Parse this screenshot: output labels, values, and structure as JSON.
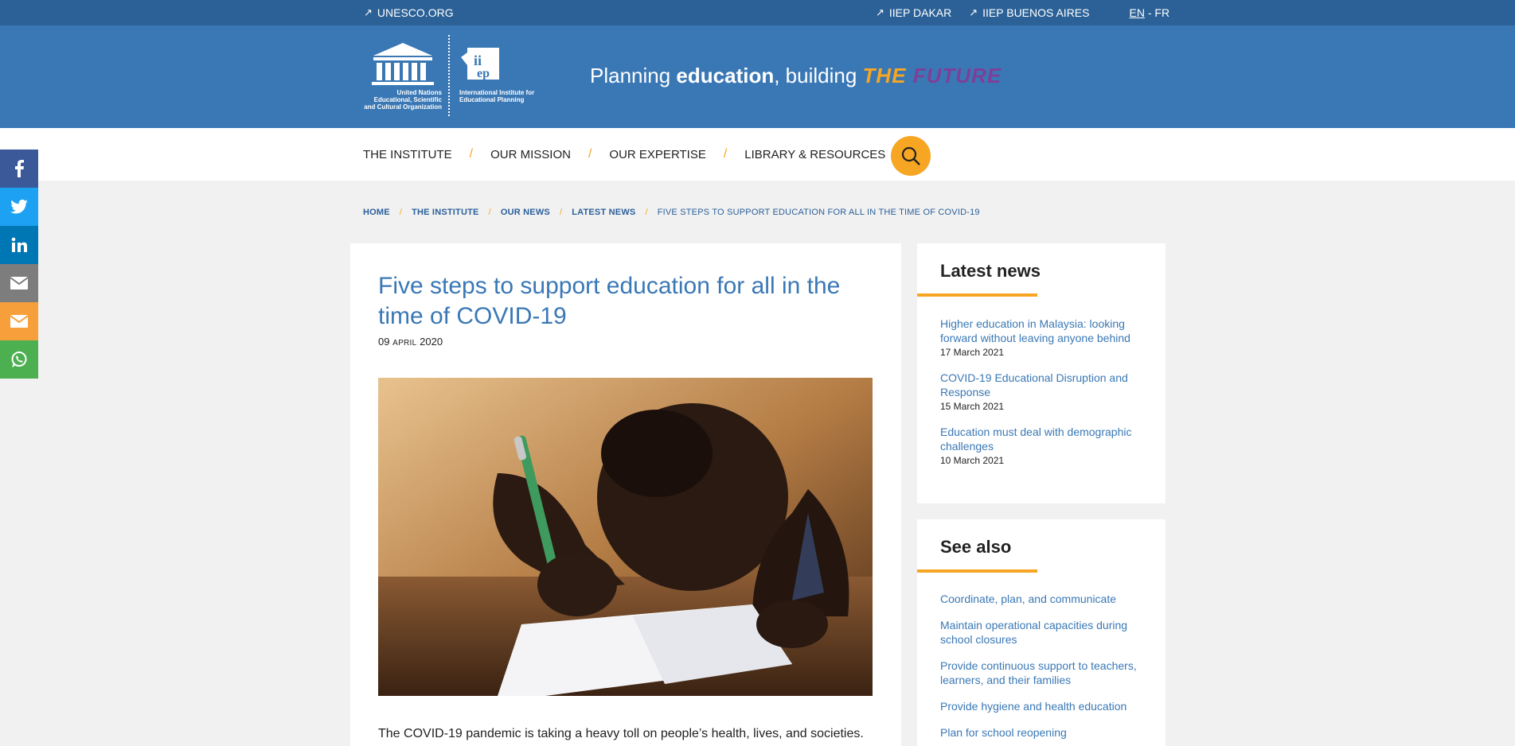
{
  "topbar": {
    "unesco_link": "UNESCO.ORG",
    "dakar_link": "IIEP DAKAR",
    "buenos_aires_link": "IIEP BUENOS AIRES",
    "lang_en": "EN",
    "lang_sep": "-",
    "lang_fr": "FR"
  },
  "header": {
    "unesco_caption": "United Nations Educational, Scientific and Cultural Organization",
    "iiep_caption": "International Institute for Educational Planning",
    "tagline_pre": "Planning ",
    "tagline_bold": "education",
    "tagline_mid": ", building ",
    "tagline_future_the": "THE",
    "tagline_future_word": "FUTURE"
  },
  "nav": {
    "items": [
      "THE INSTITUTE",
      "OUR MISSION",
      "OUR EXPERTISE",
      "LIBRARY & RESOURCES"
    ],
    "separator": "/"
  },
  "social": [
    "facebook-icon",
    "twitter-icon",
    "linkedin-icon",
    "email-icon",
    "mail-orange-icon",
    "whatsapp-icon"
  ],
  "breadcrumb": {
    "items": [
      "HOME",
      "THE INSTITUTE",
      "OUR NEWS",
      "LATEST NEWS"
    ],
    "current": "FIVE STEPS TO SUPPORT EDUCATION FOR ALL IN THE TIME OF COVID-19",
    "separator": "/"
  },
  "article": {
    "title": "Five steps to support education for all in the time of COVID-19",
    "date_day": "09",
    "date_month": "APRIL",
    "date_year": "2020",
    "body": "The COVID-19 pandemic is taking a heavy toll on people’s health, lives, and societies."
  },
  "latest_news": {
    "heading": "Latest news",
    "items": [
      {
        "title": "Higher education in Malaysia: looking forward without leaving anyone behind",
        "date": "17 March 2021"
      },
      {
        "title": "COVID-19 Educational Disruption and Response",
        "date": "15 March 2021"
      },
      {
        "title": "Education must deal with demographic challenges",
        "date": "10 March 2021"
      }
    ]
  },
  "see_also": {
    "heading": "See also",
    "items": [
      "Coordinate, plan, and communicate",
      "Maintain operational capacities during school closures",
      "Provide continuous support to teachers, learners, and their families",
      "Provide hygiene and health education",
      "Plan for school reopening"
    ]
  },
  "colors": {
    "topbar": "#2b6197",
    "header": "#3a78b5",
    "accent": "#f6a623",
    "link": "#3a78b5",
    "facebook": "#3b5998",
    "twitter": "#1da1f2",
    "linkedin": "#0077b5",
    "email": "#7d7d7d",
    "mail_orange": "#f7a03b",
    "whatsapp": "#4cb050"
  }
}
